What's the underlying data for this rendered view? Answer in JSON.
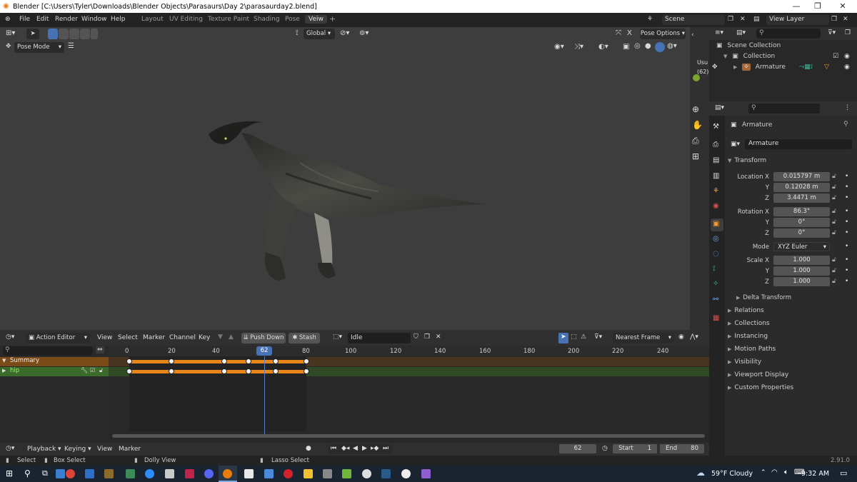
{
  "window": {
    "title": "Blender [C:\\Users\\Tyler\\Downloads\\Blender Objects\\Parasaurs\\Day 2\\parasaurday2.blend]",
    "minimize": "—",
    "maximize": "❐",
    "close": "✕"
  },
  "menubar": {
    "items": [
      "File",
      "Edit",
      "Render",
      "Window",
      "Help"
    ],
    "workspaces": [
      "Layout",
      "UV Editing",
      "Texture Paint",
      "Shading",
      "Pose",
      "Veiw"
    ],
    "active_workspace": "Veiw",
    "add_tab": "+",
    "scene_label": "Scene",
    "view_layer_label": "View Layer"
  },
  "viewport": {
    "mode": "Pose Mode",
    "orientation": "Global",
    "pose_options": "Pose Options",
    "overlay_text_1": "Usu",
    "overlay_text_2": "(62)"
  },
  "outliner": {
    "items": [
      {
        "label": "Scene Collection"
      },
      {
        "label": "Collection"
      },
      {
        "label": "Armature"
      }
    ]
  },
  "properties": {
    "object_name": "Armature",
    "data_name": "Armature",
    "transform_title": "Transform",
    "location": {
      "label": "Location X",
      "x": "0.015797 m",
      "y": "0.12028 m",
      "z": "3.4471 m"
    },
    "rotation": {
      "label": "Rotation X",
      "x": "86.3°",
      "y": "0°",
      "z": "0°"
    },
    "mode": {
      "label": "Mode",
      "value": "XYZ Euler"
    },
    "scale": {
      "label": "Scale X",
      "x": "1.000",
      "y": "1.000",
      "z": "1.000"
    },
    "axis_y": "Y",
    "axis_z": "Z",
    "delta_transform": "Delta Transform",
    "panels": [
      "Relations",
      "Collections",
      "Instancing",
      "Motion Paths",
      "Visibility",
      "Viewport Display",
      "Custom Properties"
    ]
  },
  "action_editor": {
    "editor_type": "Action Editor",
    "menus": [
      "View",
      "Select",
      "Marker",
      "Channel",
      "Key"
    ],
    "push_down": "Push Down",
    "stash": "Stash",
    "action_name": "Idle",
    "snap_mode": "Nearest Frame",
    "ruler": [
      "0",
      "20",
      "40",
      "62",
      "80",
      "100",
      "120",
      "140",
      "160",
      "180",
      "200",
      "220",
      "240"
    ],
    "current_frame": "62",
    "channels": [
      {
        "label": "Summary"
      },
      {
        "label": "hip"
      }
    ],
    "keyframes": [
      0,
      19,
      43,
      54,
      66,
      80
    ]
  },
  "timeline": {
    "menus": [
      "Playback",
      "Keying",
      "View",
      "Marker"
    ],
    "frame": "62",
    "start_label": "Start",
    "start": "1",
    "end_label": "End",
    "end": "80"
  },
  "statusbar": {
    "select": "Select",
    "box_select": "Box Select",
    "dolly_view": "Dolly View",
    "lasso_select": "Lasso Select",
    "version": "2.91.0"
  },
  "taskbar": {
    "weather": "59°F  Cloudy",
    "time": "9:32 AM"
  },
  "colors": {
    "accent_blue": "#4772b3",
    "keyframe_orange": "#e8861a",
    "summary_bg": "#7a4b16",
    "hip_bg": "#3a6b2a",
    "playhead": "#5680c2"
  }
}
